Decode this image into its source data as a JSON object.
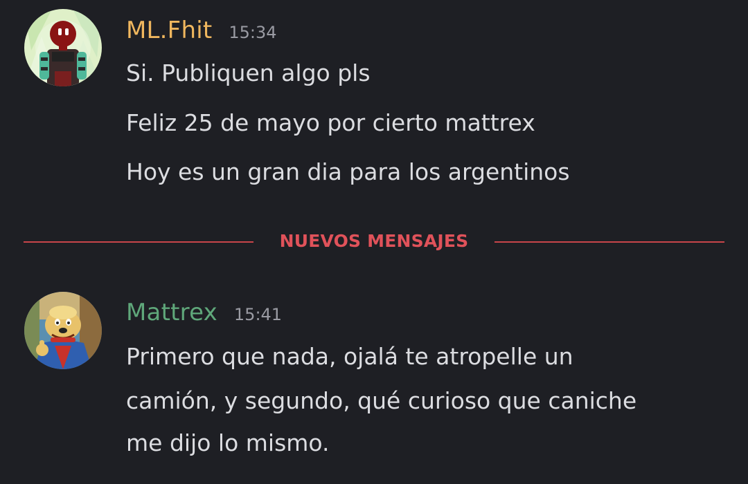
{
  "messages": [
    {
      "author": "ML.Fhit",
      "author_color": "#f0b75e",
      "time": "15:34",
      "avatar": "robot-character-avatar",
      "lines": [
        "Si. Publiquen algo pls",
        "Feliz 25 de mayo por cierto mattrex",
        "Hoy es un gran dia para los argentinos"
      ]
    },
    {
      "author": "Mattrex",
      "author_color": "#5fa77a",
      "time": "15:41",
      "avatar": "cartoon-dog-avatar",
      "lines": [
        "Primero que nada, ojalá te atropelle un",
        "camión, y segundo, qué curioso que caniche",
        "me dijo lo mismo."
      ]
    }
  ],
  "divider": {
    "label": "NUEVOS MENSAJES",
    "color": "#e0525a"
  },
  "colors": {
    "background": "#1e1f24",
    "text": "#dcdde1",
    "timestamp": "#9a9ba3"
  }
}
